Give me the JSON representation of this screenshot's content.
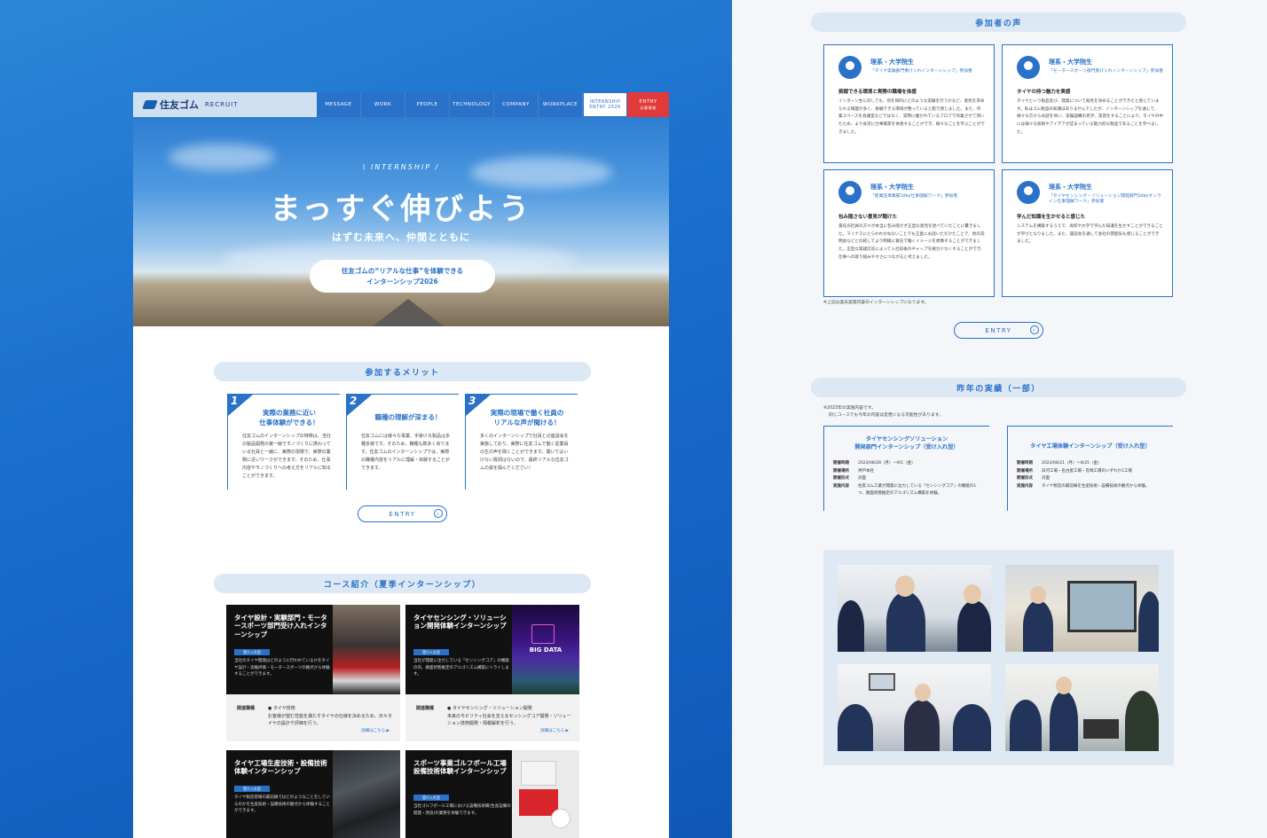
{
  "site": {
    "logo": "住友ゴム",
    "logo_suffix": "RECRUIT",
    "nav": [
      "MESSAGE",
      "WORK",
      "PEOPLE",
      "TECHNOLOGY",
      "COMPANY",
      "WORKPLACE"
    ],
    "nav_internship": [
      "INTERNSHIP",
      "ENTRY 2026"
    ],
    "nav_entry": [
      "ENTRY",
      "応募情報"
    ]
  },
  "hero": {
    "kicker": "\\ INTERNSHIP /",
    "title": "まっすぐ伸びよう",
    "subtitle": "はずむ未来へ、仲間とともに",
    "pill_line1": "住友ゴムの“リアルな仕事”を体験できる",
    "pill_line2": "インターンシップ2026"
  },
  "merits": {
    "heading": "参加するメリット",
    "items": [
      {
        "num": "1",
        "title1": "実際の業務に近い",
        "title2": "仕事体験ができる！",
        "body": "住友ゴムのインターンシップの特徴は、当社の製品開発の第一線でモノづくりに携わっている社員と一緒に、実際の現場で、実際の業務に近いワークができます。そのため、仕事内容やモノづくりへの考え方をリアルに知ることができます。"
      },
      {
        "num": "2",
        "title1": "職種の理解が深まる！",
        "title2": "",
        "body": "住友ゴムには様々な事業、手掛ける製品は多種多様です。そのため、職種も数多くあります。住友ゴムのインターンシップでは、実際の職種内容をリアルに理解・体験することができます。"
      },
      {
        "num": "3",
        "title1": "実際の現場で働く社員の",
        "title2": "リアルな声が聞ける！",
        "body": "多くのインターンシップで社員との座談会を実施しており、実際に住友ゴムで働く従業員の生の声を聞くことができます。聞いてはいけない質問はないので、最終リアルな住友ゴムの姿を掴んでください！"
      }
    ],
    "entry_button": "ENTRY"
  },
  "courses": {
    "heading": "コース紹介（夏季インターンシップ）",
    "items": [
      {
        "title": "タイヤ設計・実験部門・モータースポーツ部門受け入れインターンシップ",
        "tag": "受け入れ型",
        "desc": "当社のタイヤ開発はどのように行われているかをタイヤ設計・実験評価・モータースポーツの観点から体験することができます。",
        "field_label": "関連職種",
        "field": "● タイヤ技術",
        "field_desc": "お客様が望む性能を満たすタイヤの仕様を決めるため、日々タイヤの設計や評価を行う。",
        "more": "詳細はこちら ▶"
      },
      {
        "title": "タイヤセンシング・ソリューション開発体験インターンシップ",
        "tag": "受け入れ型",
        "desc": "当社が開発に注力している「センシングコア」の機能の内、路面状態推定のアルゴリズム構築にトライします。",
        "field_label": "関連職種",
        "field": "● タイヤセンシング・ソリューション開発",
        "field_desc": "未来のモビリティ社会を支えるセンシングコア開発・ソリューション技術開発・情報解析を行う。",
        "more": "詳細はこちら ▶",
        "image_text": "BIG DATA"
      },
      {
        "title": "タイヤ工場生産技術・設備技術体験インターンシップ",
        "tag": "受け入れ型",
        "desc": "タイヤ製造現場の最前線ではどのようなことをしているのかを生産技術・設備技術の観点から体験することができます。"
      },
      {
        "title": "スポーツ事業ゴルフボール工場設備技術体験インターンシップ",
        "tag": "受け入れ型",
        "desc": "当社ゴルフボール工場における設備技術職(生産設備の開発・改良)の業務を体験できます。"
      }
    ]
  },
  "voices": {
    "heading": "参加者の声",
    "items": [
      {
        "who": "理系・大学院生",
        "program": "「タイヤ実験部門受け入れインターンシップ」参加者",
        "title": "挑戦できる環境と実際の職場を体感",
        "body": "インターン生に対しても、何を目的にどのような実験を行うかなど、意見を求められる場面が多く、挑戦できる環境が整っていると肌で感じました。また、作業スペースを会議室などではなく、実際に働かれているフロアで作業させて頂いたため、より身近に仕事風景を体感することができ、様々なことを学ぶことができました。"
      },
      {
        "who": "理系・大学院生",
        "program": "「モータースポーツ部門受け入れインターンシップ」参加者",
        "title": "タイヤの持つ魅力を実感",
        "body": "タイヤという製品及び、開発について知見を深めることができたと感じています。私はゴム製品の知識はありませんでしたが、インターンシップを通じて、様々な方からお話を伺い、実験設備の見学、実習をすることにより、タイヤの中には様々な技術やアイデアが詰まっている魅力的な製品であることを学べました。"
      },
      {
        "who": "理系・大学院生",
        "program": "「産業品事業部1day仕事理解ワーク」参加者",
        "title": "包み隠さない意見が聞けた",
        "body": "責任の社員の方々が本当に包み隠さず正直な意見を述べていたことに驚きました。マイナスにとらわれかねないことでも正直にお話いただけたことで、他の説明会などと比較してより明確に責任で働くイメージを想像することができました。正直な質疑応答によって入社前後のギャップを極力少なくすることができ、仕事への取り組みやすさにつながると考えました。"
      },
      {
        "who": "理系・大学院生",
        "program": "「タイヤセンシング・ソリューション開発部門1dayオンライン仕事理解ワーク」参加者",
        "title": "学んだ知識を生かせると感じた",
        "body": "システムを構築するうえで、高校や大学で学んだ知識を生かすことができることが学びとなりました。また、座談会を通して会社の雰囲気も感じることができました。"
      }
    ],
    "footnote": "※上記は過去実施内容のインターンシップになります。",
    "entry_button": "ENTRY"
  },
  "results": {
    "heading": "昨年の実績（一部）",
    "note1": "※2023年の実施内容です。",
    "note2": "同じコースでも今年の内容は変更になる可能性があります。",
    "items": [
      {
        "title1": "タイヤセンシングソリューション",
        "title2": "開発部門インターンシップ（受け入れ型）",
        "rows": [
          [
            "開催時期",
            "2023/08/28（月）〜9/1（金）"
          ],
          [
            "開催場所",
            "神戸本社"
          ],
          [
            "開催形式",
            "対面"
          ],
          [
            "実施内容",
            "住友ゴム工業が開発に注力している「センシングコア」の機能の1つ、路面状態推定のアルゴリズム構築を体験。"
          ]
        ]
      },
      {
        "title1": "タイヤ工場体験インターンシップ（受け入れ型）",
        "title2": "",
        "rows": [
          [
            "開催時期",
            "2023/08/21（月）〜8/25（金）"
          ],
          [
            "開催場所",
            "白河工場・名古屋工場・宮崎工場のいずれか1工場"
          ],
          [
            "開催形式",
            "対面"
          ],
          [
            "実施内容",
            "タイヤ製造の最前線を生産技術・設備技術の観点から体験。"
          ]
        ]
      }
    ]
  },
  "colors": {
    "accent": "#2a72c9",
    "entry_red": "#e23a3a",
    "background_blue": "#1566c4",
    "section_bar": "#dce8f4"
  }
}
